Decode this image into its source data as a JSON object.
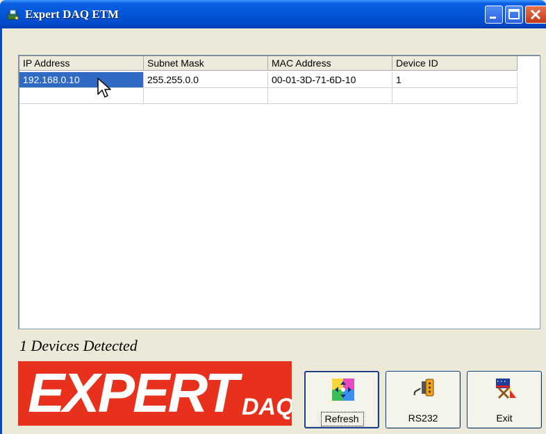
{
  "window": {
    "title": "Expert DAQ ETM",
    "controls": [
      "minimize",
      "maximize",
      "close"
    ]
  },
  "table": {
    "columns": [
      "IP Address",
      "Subnet Mask",
      "MAC Address",
      "Device ID"
    ],
    "rows": [
      [
        "192.168.0.10",
        "255.255.0.0",
        "00-01-3D-71-6D-10",
        "1"
      ]
    ],
    "selected_row": 0
  },
  "status": {
    "text": "1 Devices Detected"
  },
  "logo": {
    "main": "EXPERT",
    "sub": "DAQ",
    "background": "#e8311c"
  },
  "buttons": {
    "refresh": {
      "label": "Refresh",
      "icon": "refresh-puzzle-icon"
    },
    "rs232": {
      "label": "RS232",
      "icon": "serial-cable-icon"
    },
    "exit": {
      "label": "Exit",
      "icon": "exit-flag-icon"
    }
  }
}
